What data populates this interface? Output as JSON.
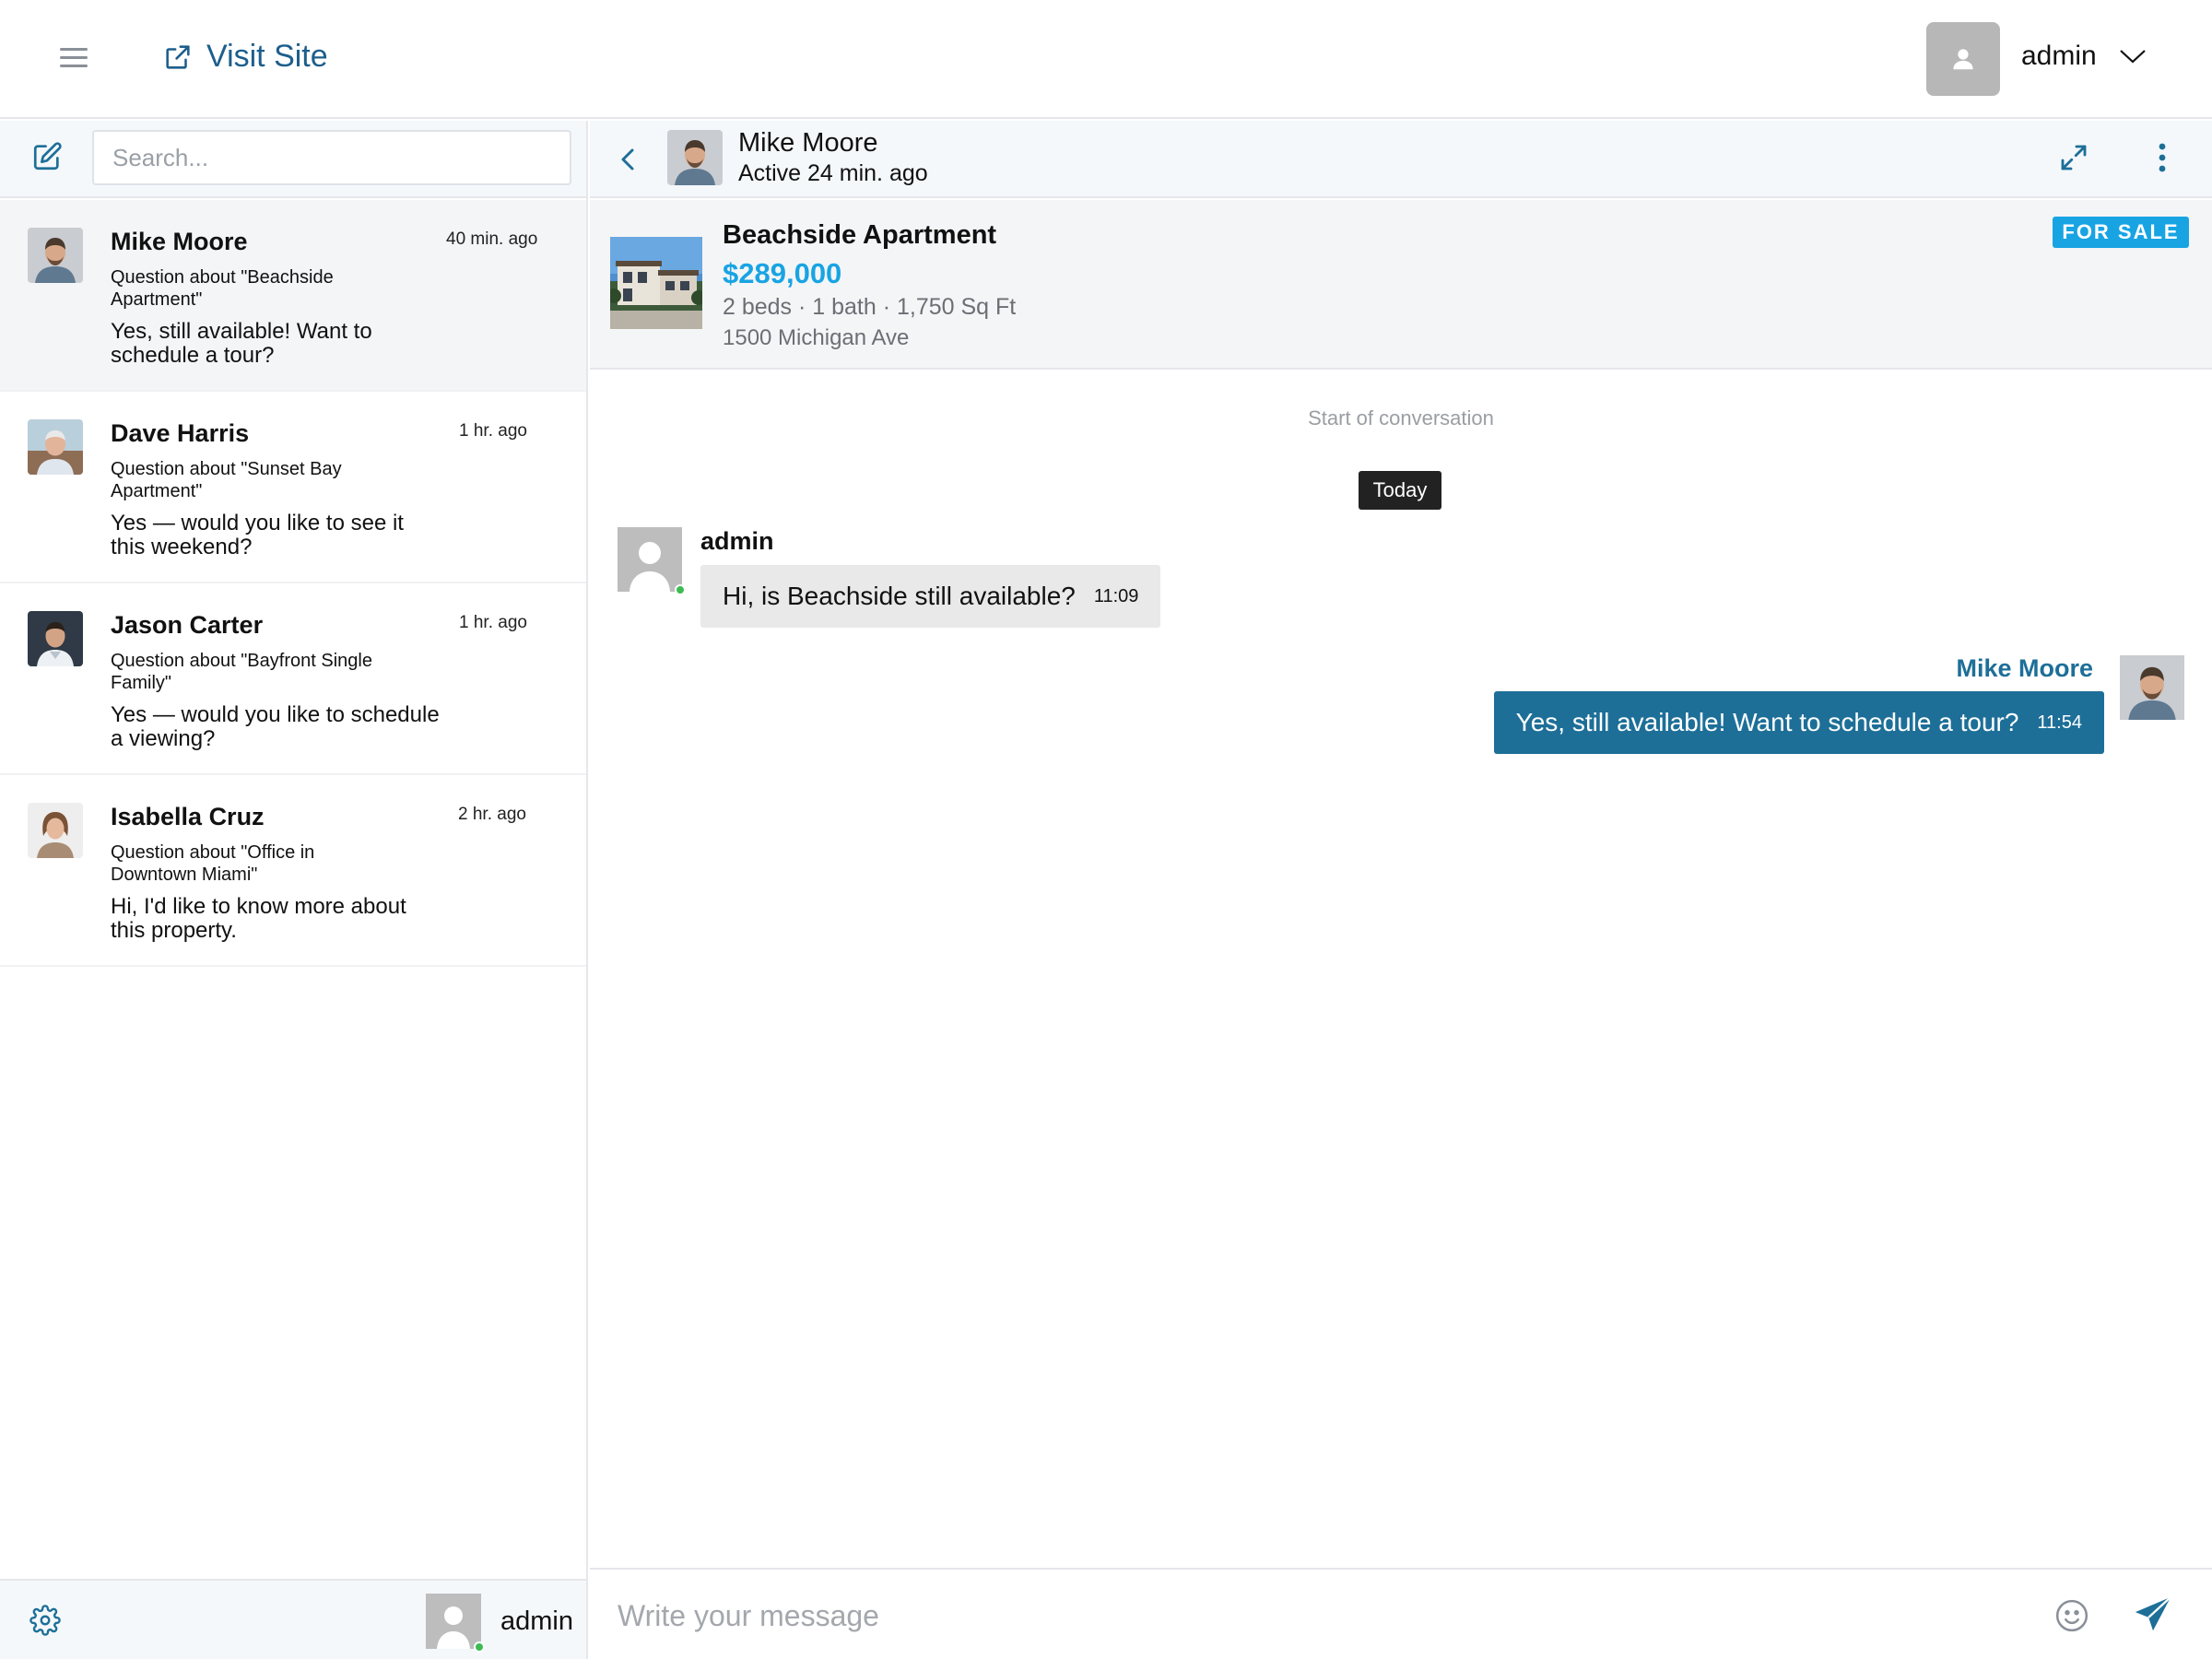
{
  "topbar": {
    "visit_site_label": "Visit Site",
    "user_name": "admin"
  },
  "sidebar": {
    "search_placeholder": "Search...",
    "conversations": [
      {
        "name": "Mike Moore",
        "time": "40 min. ago",
        "about": "Question about \"Beachside Apartment\"",
        "preview": "Yes, still available! Want to schedule a tour?"
      },
      {
        "name": "Dave Harris",
        "time": "1 hr. ago",
        "about": "Question about \"Sunset Bay Apartment\"",
        "preview": "Yes — would you like to see it this weekend?"
      },
      {
        "name": "Jason Carter",
        "time": "1 hr. ago",
        "about": "Question about \"Bayfront Single Family\"",
        "preview": "Yes — would you like to schedule a viewing?"
      },
      {
        "name": "Isabella Cruz",
        "time": "2 hr. ago",
        "about": "Question about \"Office in Downtown Miami\"",
        "preview": "Hi, I'd like to know more about this property."
      }
    ],
    "footer_user": "admin"
  },
  "chat": {
    "contact_name": "Mike Moore",
    "contact_status": "Active 24 min. ago",
    "listing": {
      "title": "Beachside Apartment",
      "price": "$289,000",
      "specs": "2 beds · 1 bath · 1,750 Sq Ft",
      "address": "1500 Michigan Ave",
      "badge": "FOR SALE"
    },
    "start_label": "Start of conversation",
    "day_label": "Today",
    "messages": [
      {
        "sender": "admin",
        "text": "Hi, is Beachside still available?",
        "time": "11:09"
      },
      {
        "sender": "Mike Moore",
        "text": "Yes, still available! Want to schedule a tour?",
        "time": "11:54"
      }
    ],
    "composer_placeholder": "Write your message"
  },
  "colors": {
    "accent": "#1d6f98",
    "link": "#1d5e8c",
    "price": "#18a4e3",
    "badge": "#18a4e3",
    "online": "#3dbb52"
  },
  "icons": [
    "menu-icon",
    "external-link-icon",
    "user-icon",
    "chevron-down-icon",
    "compose-icon",
    "settings-icon",
    "back-icon",
    "expand-icon",
    "more-vertical-icon",
    "emoji-icon",
    "send-icon"
  ]
}
